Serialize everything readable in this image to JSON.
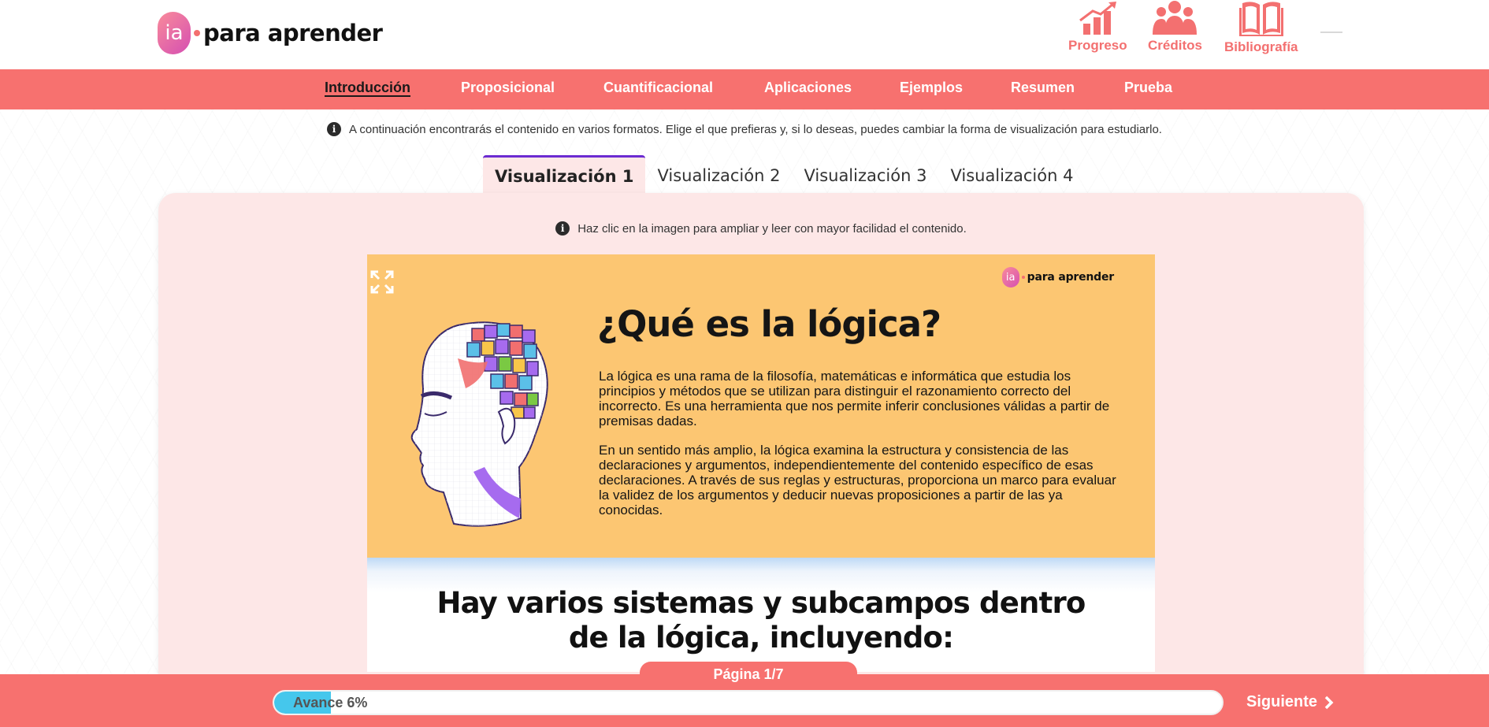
{
  "brand": {
    "badge": "ia",
    "name": "para aprender"
  },
  "top_actions": [
    {
      "label": "Progreso",
      "icon": "chart-up-icon"
    },
    {
      "label": "Créditos",
      "icon": "people-icon"
    },
    {
      "label": "Bibliografía",
      "icon": "book-icon"
    }
  ],
  "nav": {
    "items": [
      {
        "label": "Introducción",
        "active": true
      },
      {
        "label": "Proposicional"
      },
      {
        "label": "Cuantificacional"
      },
      {
        "label": "Aplicaciones"
      },
      {
        "label": "Ejemplos"
      },
      {
        "label": "Resumen"
      },
      {
        "label": "Prueba"
      }
    ]
  },
  "info_text": "A continuación encontrarás el contenido en varios formatos. Elige el que prefieras y, si lo deseas, puedes cambiar la forma de visualización para estudiarlo.",
  "tabs": [
    {
      "label": "Visualización 1",
      "active": true
    },
    {
      "label": "Visualización 2"
    },
    {
      "label": "Visualización 3"
    },
    {
      "label": "Visualización 4"
    }
  ],
  "panel_info": "Haz clic en la imagen para ampliar y leer con mayor facilidad el contenido.",
  "slide": {
    "logo_badge": "ia",
    "logo_text": "para aprender",
    "title": "¿Qué es la lógica?",
    "paragraph1": "La lógica es una rama de la filosofía, matemáticas e informática que estudia los principios y métodos que se utilizan para distinguir el razonamiento correcto del incorrecto. Es una herramienta que nos permite inferir conclusiones válidas a partir de premisas dadas.",
    "paragraph2": "En un sentido más amplio, la lógica examina la estructura y consistencia de las declaraciones y argumentos, independientemente del contenido específico de esas declaraciones. A través de sus reglas y estructuras, proporciona un marco para evaluar la validez de los argumentos y deducir nuevas proposiciones a partir de las ya conocidas.",
    "subtitle_line1": "Hay varios sistemas y subcampos dentro",
    "subtitle_line2": "de la lógica, incluyendo:"
  },
  "pagination": "Página 1/7",
  "progress": {
    "label": "Avance 6%",
    "value": 0.06
  },
  "next_label": "Siguiente",
  "colors": {
    "accent": "#f7716f",
    "panel": "#fde7e7",
    "slide": "#fcc672",
    "progress": "#45c7ec",
    "tab_active": "#6b2bd1"
  }
}
